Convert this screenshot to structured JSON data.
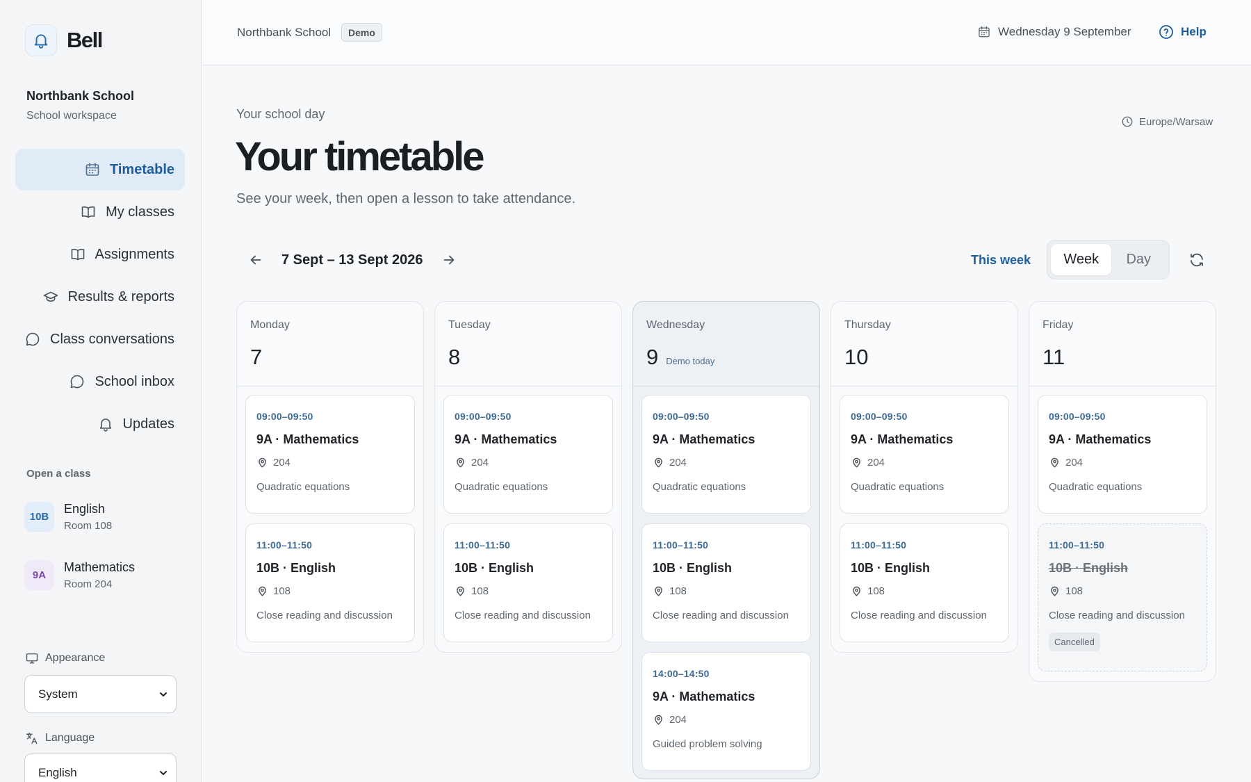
{
  "brand": {
    "name": "Bell",
    "icon": "bell-icon"
  },
  "workspace": {
    "name": "Northbank School",
    "subtitle": "School workspace"
  },
  "nav": [
    {
      "label": "Timetable",
      "icon": "calendar-icon",
      "active": true
    },
    {
      "label": "My classes",
      "icon": "book-icon"
    },
    {
      "label": "Assignments",
      "icon": "book-icon"
    },
    {
      "label": "Results & reports",
      "icon": "graduation-cap-icon"
    },
    {
      "label": "Class conversations",
      "icon": "chat-bubble-icon"
    },
    {
      "label": "School inbox",
      "icon": "chat-bubble-icon"
    },
    {
      "label": "Updates",
      "icon": "bell-icon"
    }
  ],
  "classes_section": {
    "label": "Open a class",
    "items": [
      {
        "badge": "10B",
        "name": "English",
        "room": "Room 108",
        "accent": "#2b6aa8"
      },
      {
        "badge": "9A",
        "name": "Mathematics",
        "room": "Room 204",
        "accent": "#7a4da6"
      }
    ]
  },
  "settings": {
    "appearance": {
      "label": "Appearance",
      "value": "System",
      "icon": "monitor-icon"
    },
    "language": {
      "label": "Language",
      "value": "English",
      "icon": "translate-icon"
    }
  },
  "topbar": {
    "school": "Northbank School",
    "badge": "Demo",
    "date": "Wednesday 9 September",
    "help": "Help"
  },
  "header": {
    "eyebrow": "Your school day",
    "title": "Your timetable",
    "subtitle": "See your week, then open a lesson to take attendance.",
    "timezone": "Europe/Warsaw"
  },
  "week_controls": {
    "range": "7 Sept – 13 Sept 2026",
    "this_week": "This week",
    "views": [
      "Week",
      "Day"
    ],
    "selected_view": "Week"
  },
  "days": [
    {
      "name": "Monday",
      "num": "7",
      "today_label": "",
      "lessons": [
        {
          "time": "09:00–09:50",
          "title": "9A · Mathematics",
          "room": "204",
          "topic": "Quadratic equations"
        },
        {
          "time": "11:00–11:50",
          "title": "10B · English",
          "room": "108",
          "topic": "Close reading and discussion"
        }
      ]
    },
    {
      "name": "Tuesday",
      "num": "8",
      "today_label": "",
      "lessons": [
        {
          "time": "09:00–09:50",
          "title": "9A · Mathematics",
          "room": "204",
          "topic": "Quadratic equations"
        },
        {
          "time": "11:00–11:50",
          "title": "10B · English",
          "room": "108",
          "topic": "Close reading and discussion"
        }
      ]
    },
    {
      "name": "Wednesday",
      "num": "9",
      "today_label": "Demo today",
      "lessons": [
        {
          "time": "09:00–09:50",
          "title": "9A · Mathematics",
          "room": "204",
          "topic": "Quadratic equations"
        },
        {
          "time": "11:00–11:50",
          "title": "10B · English",
          "room": "108",
          "topic": "Close reading and discussion"
        },
        {
          "time": "14:00–14:50",
          "title": "9A · Mathematics",
          "room": "204",
          "topic": "Guided problem solving"
        }
      ]
    },
    {
      "name": "Thursday",
      "num": "10",
      "today_label": "",
      "lessons": [
        {
          "time": "09:00–09:50",
          "title": "9A · Mathematics",
          "room": "204",
          "topic": "Quadratic equations"
        },
        {
          "time": "11:00–11:50",
          "title": "10B · English",
          "room": "108",
          "topic": "Close reading and discussion"
        }
      ]
    },
    {
      "name": "Friday",
      "num": "11",
      "today_label": "",
      "lessons": [
        {
          "time": "09:00–09:50",
          "title": "9A · Mathematics",
          "room": "204",
          "topic": "Quadratic equations"
        },
        {
          "time": "11:00–11:50",
          "title": "10B · English",
          "room": "108",
          "topic": "Close reading and discussion",
          "status": "Cancelled"
        }
      ]
    }
  ],
  "colors": {
    "accent": "#1c5d9a",
    "active_nav_bg": "#e1ebf8",
    "today_column_bg": "#edf1f6",
    "lesson_time": "#3c6a94"
  }
}
